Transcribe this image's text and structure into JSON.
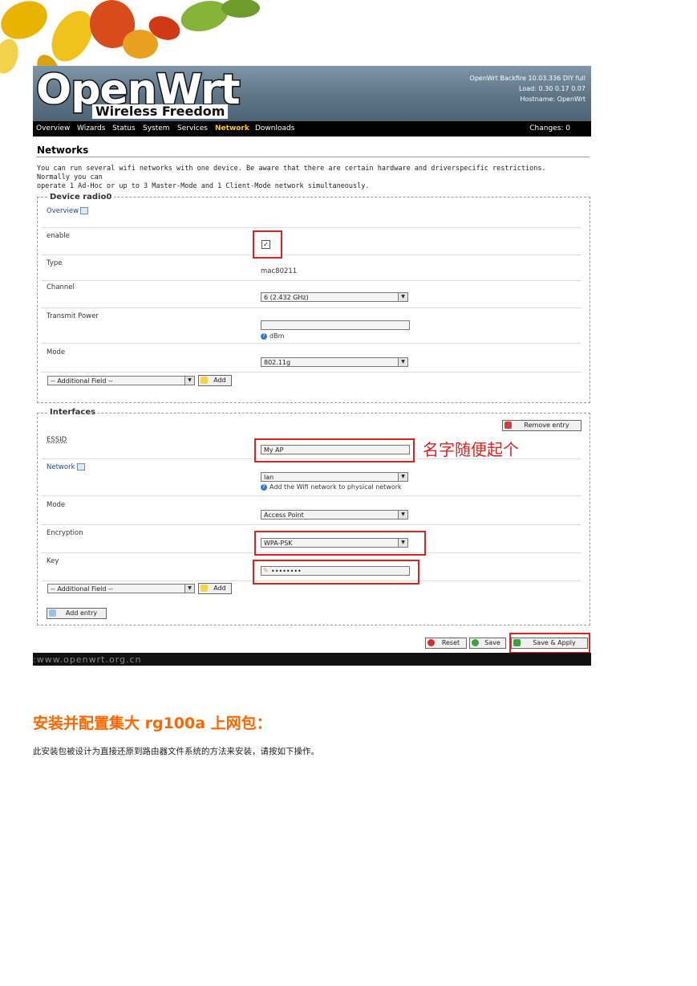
{
  "header": {
    "logo_main": "OpenWrt",
    "logo_sub": "Wireless Freedom",
    "info_line1": "OpenWrt Backfire 10.03.336 DIY full",
    "info_line2": "Load: 0.30 0.17 0.07",
    "info_line3": "Hostname: OpenWrt"
  },
  "nav": {
    "items": [
      "Overview",
      "Wizards",
      "Status",
      "System",
      "Services",
      "Network",
      "Downloads"
    ],
    "active": "Network",
    "changes": "Changes: 0"
  },
  "page": {
    "title": "Networks",
    "intro_line1": "You can run several wifi networks with one device. Be aware that there are certain hardware and driverspecific restrictions. Normally you can",
    "intro_line2": "operate 1 Ad-Hoc or up to 3 Master-Mode and 1 Client-Mode network simultaneously."
  },
  "device": {
    "legend": "Device radio0",
    "overview_label": "Overview",
    "enable_label": "enable",
    "enable_checked": "✓",
    "type_label": "Type",
    "type_value": "mac80211",
    "channel_label": "Channel",
    "channel_value": "6 (2.432 GHz)",
    "txpower_label": "Transmit Power",
    "txpower_value": "",
    "txpower_unit": "dBm",
    "mode_label": "Mode",
    "mode_value": "802.11g",
    "additional_field": "-- Additional Field --",
    "add_button": "Add"
  },
  "interfaces": {
    "legend": "Interfaces",
    "remove_entry": "Remove entry",
    "essid_label": "ESSID",
    "essid_value": "My AP",
    "network_label": "Network",
    "network_value": "lan",
    "network_help": "Add the Wifi network to physical network",
    "mode_label": "Mode",
    "mode_value": "Access Point",
    "encryption_label": "Encryption",
    "encryption_value": "WPA-PSK",
    "key_label": "Key",
    "key_value": "••••••••",
    "additional_field": "-- Additional Field --",
    "add_button": "Add",
    "add_entry": "Add entry"
  },
  "actions": {
    "reset": "Reset",
    "save": "Save",
    "save_apply": "Save & Apply"
  },
  "annotation": "名字随便起个",
  "footer_url": ":www.openwrt.org.cn",
  "doc": {
    "heading": "安装并配置集大 rg100a 上网包：",
    "body": "此安装包被设计为直接还原到路由器文件系统的方法来安装，请按如下操作。"
  },
  "colors": {
    "accent_orange": "#ff6600",
    "annotation_red": "#e02020",
    "nav_active": "#ffcc00"
  }
}
